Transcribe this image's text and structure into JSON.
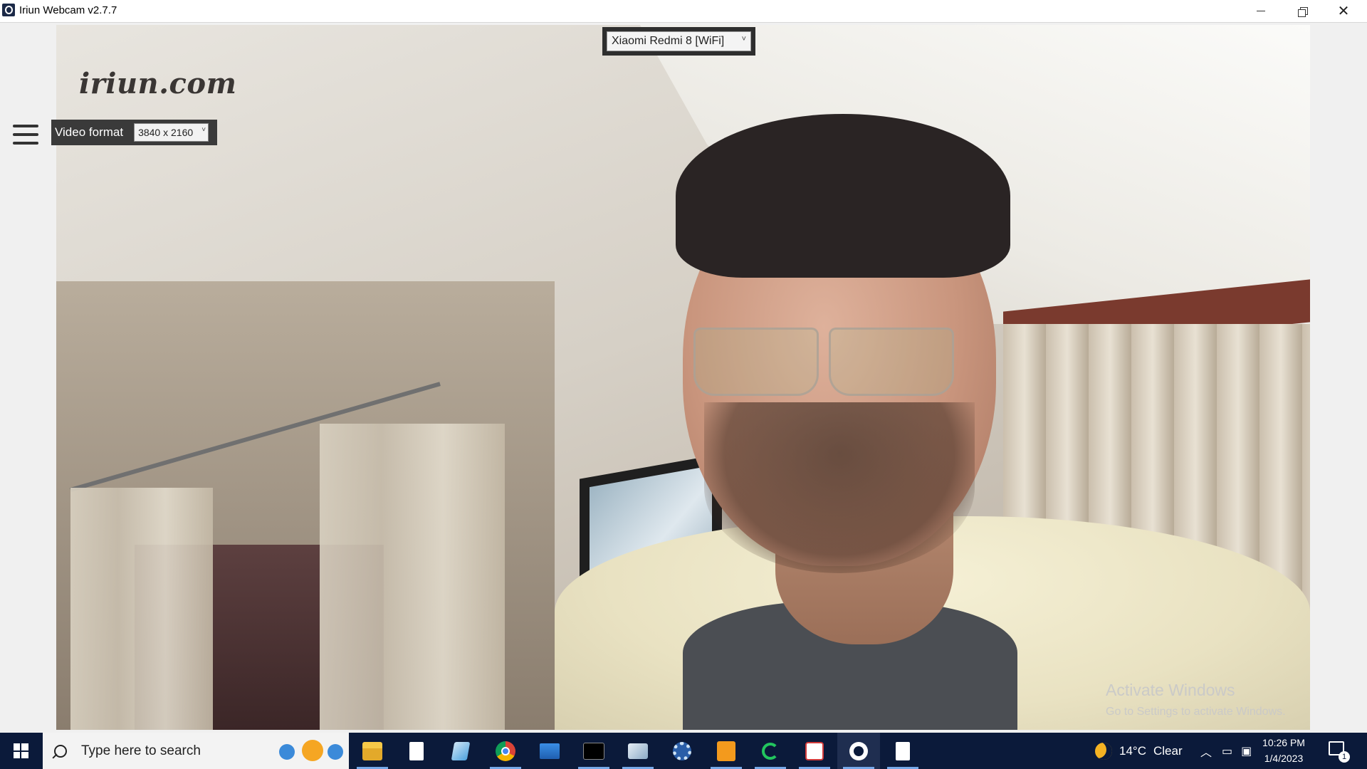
{
  "window": {
    "title": "Iriun Webcam v2.7.7",
    "controls": [
      "minimize",
      "restore",
      "close"
    ]
  },
  "overlay": {
    "logo_text": "iriun.com",
    "device_select": {
      "value": "Xiaomi Redmi 8 [WiFi]"
    },
    "video_format": {
      "label": "Video format",
      "value": "3840 x 2160"
    },
    "activate_windows": {
      "title": "Activate Windows",
      "subtitle": "Go to Settings to activate Windows."
    }
  },
  "taskbar": {
    "search_placeholder": "Type here to search",
    "apps": [
      {
        "name": "file-explorer-icon"
      },
      {
        "name": "notepad-icon"
      },
      {
        "name": "tablet-app-icon"
      },
      {
        "name": "chrome-icon"
      },
      {
        "name": "remote-desktop-icon"
      },
      {
        "name": "command-prompt-icon"
      },
      {
        "name": "image-viewer-icon"
      },
      {
        "name": "settings-gear-icon"
      },
      {
        "name": "pdf-app-icon"
      },
      {
        "name": "green-ring-app-icon"
      },
      {
        "name": "ks-app-icon"
      },
      {
        "name": "iriun-webcam-icon",
        "active": true
      },
      {
        "name": "document-icon"
      }
    ],
    "weather": {
      "temperature": "14°C",
      "condition": "Clear"
    },
    "clock": {
      "time": "10:26 PM",
      "date": "1/4/2023"
    },
    "notification_count": "1"
  }
}
